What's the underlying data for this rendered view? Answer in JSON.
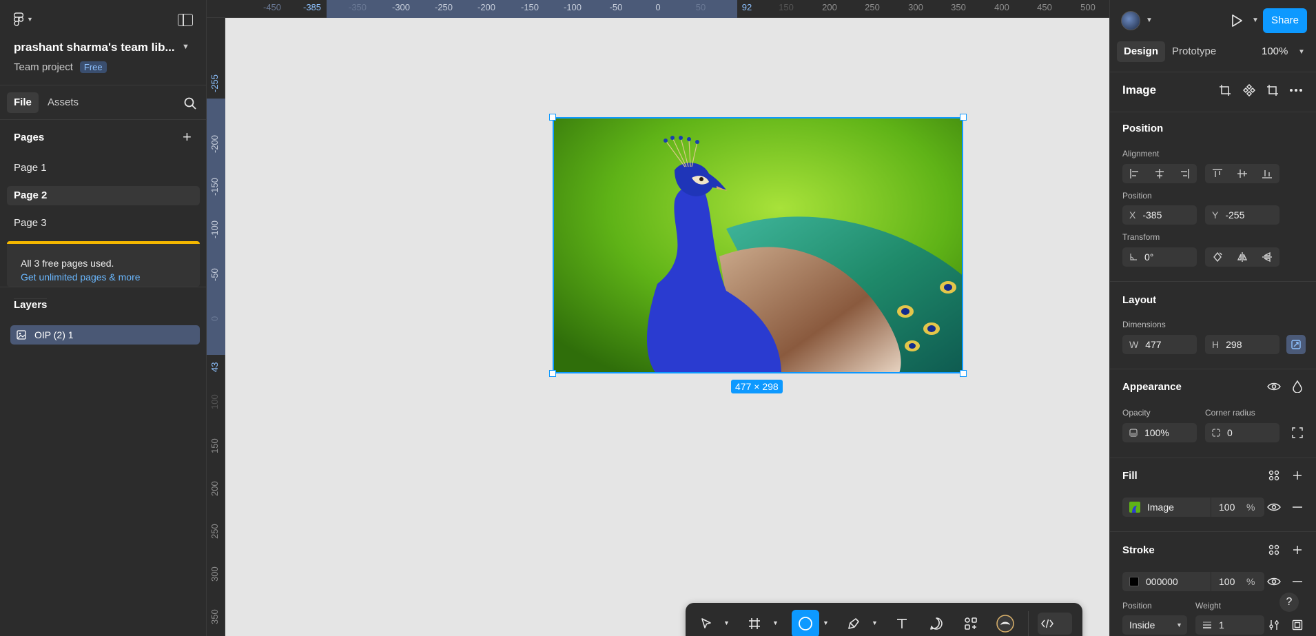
{
  "team": {
    "title": "prashant sharma's team lib...",
    "project_label": "Team project",
    "plan_badge": "Free"
  },
  "left_tabs": {
    "file": "File",
    "assets": "Assets"
  },
  "pages": {
    "header": "Pages",
    "items": [
      "Page 1",
      "Page 2",
      "Page 3"
    ],
    "active": "Page 2"
  },
  "notice": {
    "text": "All 3 free pages used.",
    "link": "Get unlimited pages & more"
  },
  "layers": {
    "header": "Layers",
    "items": [
      "OIP (2) 1"
    ]
  },
  "ruler_top": {
    "labels": [
      "-450",
      "-385",
      "-350",
      "-300",
      "-250",
      "-200",
      "-150",
      "-100",
      "-50",
      "0",
      "50",
      "92",
      "150",
      "200",
      "250",
      "300",
      "350",
      "400",
      "450",
      "500"
    ]
  },
  "ruler_left": {
    "labels": [
      "-255",
      "-200",
      "-150",
      "-100",
      "-50",
      "0",
      "43",
      "100",
      "150",
      "200",
      "250",
      "300",
      "350"
    ]
  },
  "selection": {
    "size_label": "477 × 298"
  },
  "header_right": {
    "share": "Share",
    "tab_design": "Design",
    "tab_prototype": "Prototype",
    "zoom": "100%"
  },
  "panel": {
    "layer_type": "Image",
    "position": {
      "title": "Position",
      "alignment_label": "Alignment",
      "position_label": "Position",
      "x_prefix": "X",
      "x": "-385",
      "y_prefix": "Y",
      "y": "-255",
      "transform_label": "Transform",
      "rotation": "0°"
    },
    "layout": {
      "title": "Layout",
      "dimensions_label": "Dimensions",
      "w_prefix": "W",
      "w": "477",
      "h_prefix": "H",
      "h": "298"
    },
    "appearance": {
      "title": "Appearance",
      "opacity_label": "Opacity",
      "opacity": "100%",
      "radius_label": "Corner radius",
      "radius": "0"
    },
    "fill": {
      "title": "Fill",
      "type": "Image",
      "opacity": "100",
      "unit": "%"
    },
    "stroke": {
      "title": "Stroke",
      "color": "000000",
      "opacity": "100",
      "unit": "%",
      "position_label": "Position",
      "weight_label": "Weight",
      "position": "Inside",
      "weight": "1"
    }
  },
  "colors": {
    "accent": "#0d99ff",
    "panel": "#2c2c2c",
    "canvas": "#e5e5e5",
    "selection_ruler": "#4b5a78",
    "notice_bar": "#f5b800"
  }
}
